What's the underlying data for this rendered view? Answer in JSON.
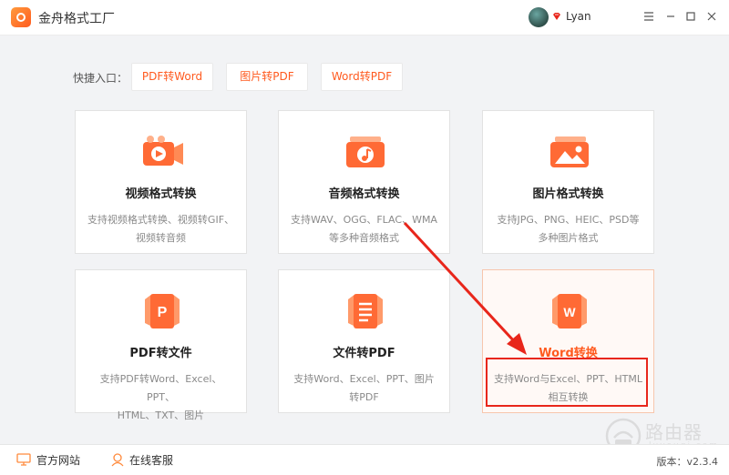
{
  "app": {
    "title": "金舟格式工厂",
    "user_name": "Lyan"
  },
  "quick_access": {
    "label": "快捷入口：",
    "items": [
      "PDF转Word",
      "图片转PDF",
      "Word转PDF"
    ]
  },
  "cards": [
    {
      "title": "视频格式转换",
      "desc_line1": "支持视频格式转换、视频转GIF、",
      "desc_line2": "视频转音频",
      "icon": "video-icon"
    },
    {
      "title": "音频格式转换",
      "desc_line1": "支持WAV、OGG、FLAC、WMA",
      "desc_line2": "等多种音频格式",
      "icon": "audio-icon"
    },
    {
      "title": "图片格式转换",
      "desc_line1": "支持JPG、PNG、HEIC、PSD等",
      "desc_line2": "多种图片格式",
      "icon": "image-icon"
    },
    {
      "title": "PDF转文件",
      "desc_line1": "支持PDF转Word、Excel、PPT、",
      "desc_line2": "HTML、TXT、图片",
      "icon": "pdf-icon"
    },
    {
      "title": "文件转PDF",
      "desc_line1": "支持Word、Excel、PPT、图片",
      "desc_line2": "转PDF",
      "icon": "document-icon"
    },
    {
      "title": "Word转换",
      "desc_line1": "支持Word与Excel、PPT、HTML",
      "desc_line2": "相互转换",
      "icon": "word-icon"
    }
  ],
  "footer": {
    "website_label": "官方网站",
    "support_label": "在线客服",
    "version": "版本：v2.3.4"
  },
  "watermark": {
    "text": "路由器",
    "sub": "luyouqi.com"
  },
  "colors": {
    "accent": "#ff5a1f",
    "annotation": "#e8261b"
  }
}
